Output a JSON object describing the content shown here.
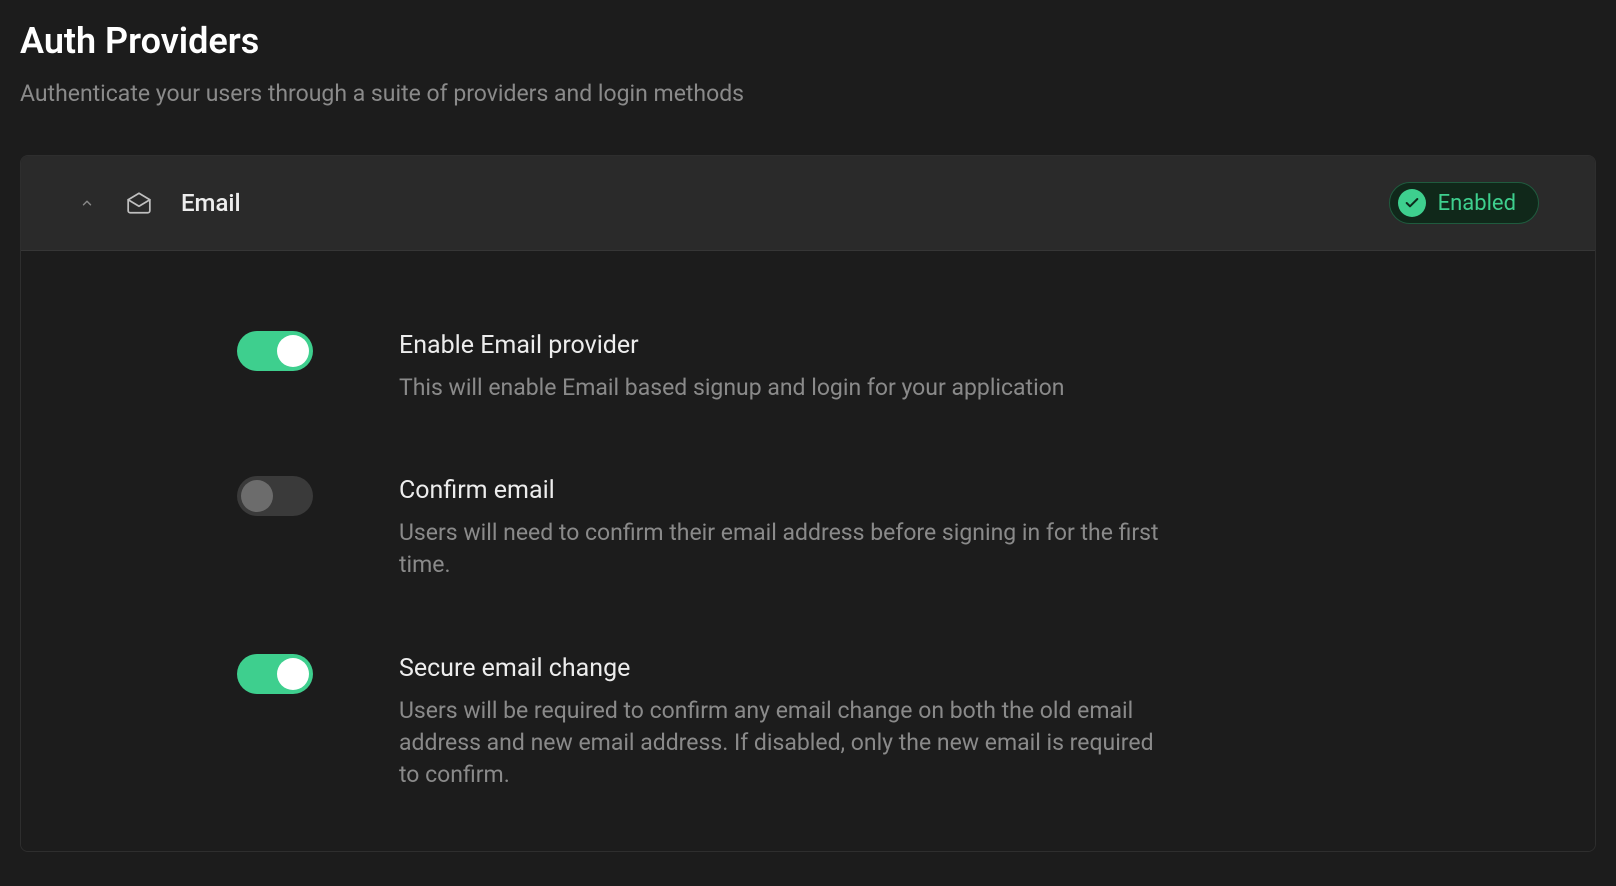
{
  "header": {
    "title": "Auth Providers",
    "subtitle": "Authenticate your users through a suite of providers and login methods"
  },
  "provider": {
    "name": "Email",
    "status_label": "Enabled"
  },
  "settings": [
    {
      "title": "Enable Email provider",
      "desc": "This will enable Email based signup and login for your application",
      "on": true
    },
    {
      "title": "Confirm email",
      "desc": "Users will need to confirm their email address before signing in for the first time.",
      "on": false
    },
    {
      "title": "Secure email change",
      "desc": "Users will be required to confirm any email change on both the old email address and new email address. If disabled, only the new email is required to confirm.",
      "on": true
    }
  ]
}
